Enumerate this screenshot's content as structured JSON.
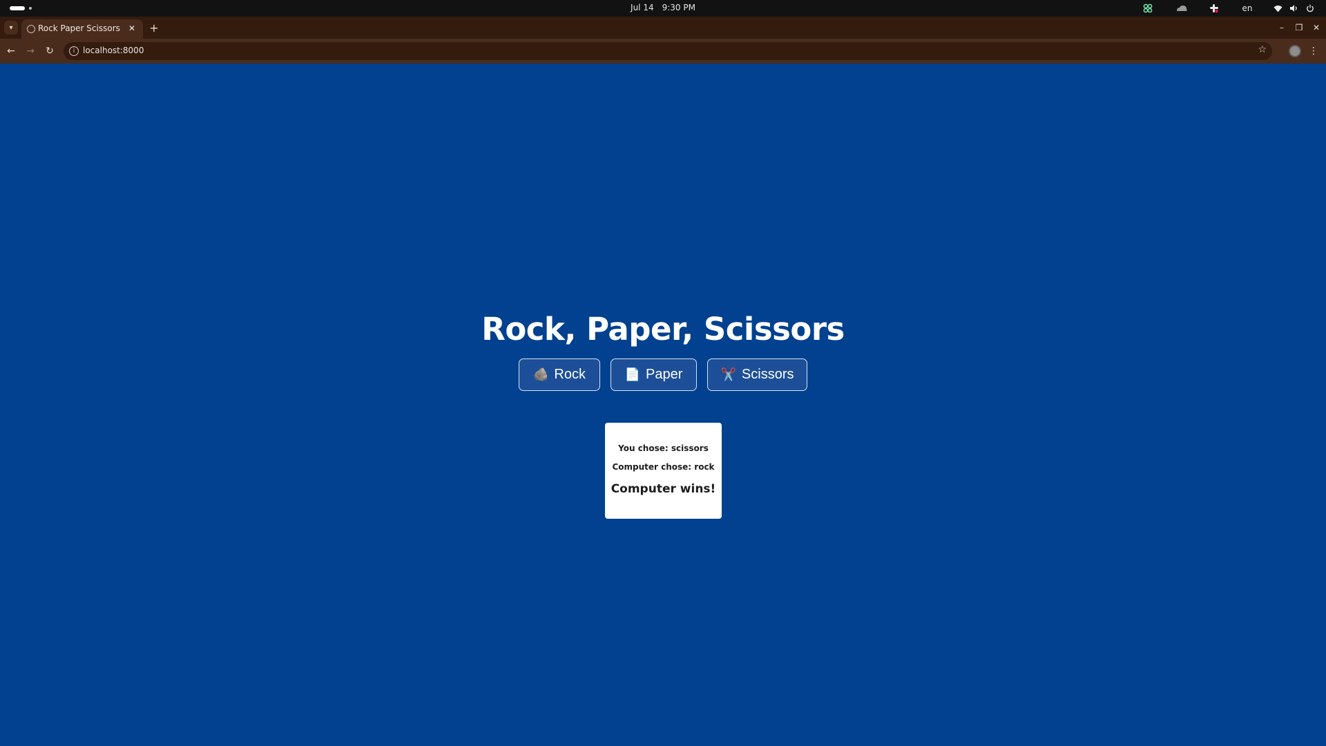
{
  "os": {
    "date": "Jul 14",
    "time": "9:30 PM",
    "lang": "en"
  },
  "browser": {
    "tab_title": "Rock Paper Scissors",
    "url": "localhost:8000"
  },
  "game": {
    "title": "Rock, Paper, Scissors",
    "buttons": [
      {
        "emoji": "🪨",
        "label": "Rock"
      },
      {
        "emoji": "📄",
        "label": "Paper"
      },
      {
        "emoji": "✂️",
        "label": "Scissors"
      }
    ],
    "result": {
      "player_prefix": "You chose:",
      "player_choice": "scissors",
      "computer_prefix": "Computer chose:",
      "computer_choice": "rock",
      "outcome": "Computer wins!"
    }
  },
  "colors": {
    "page_background": "#01418f",
    "button_background": "#1d4f98",
    "card_background": "#ffffff",
    "browser_frame": "#331b0e",
    "browser_toolbar": "#4a2c1c"
  }
}
